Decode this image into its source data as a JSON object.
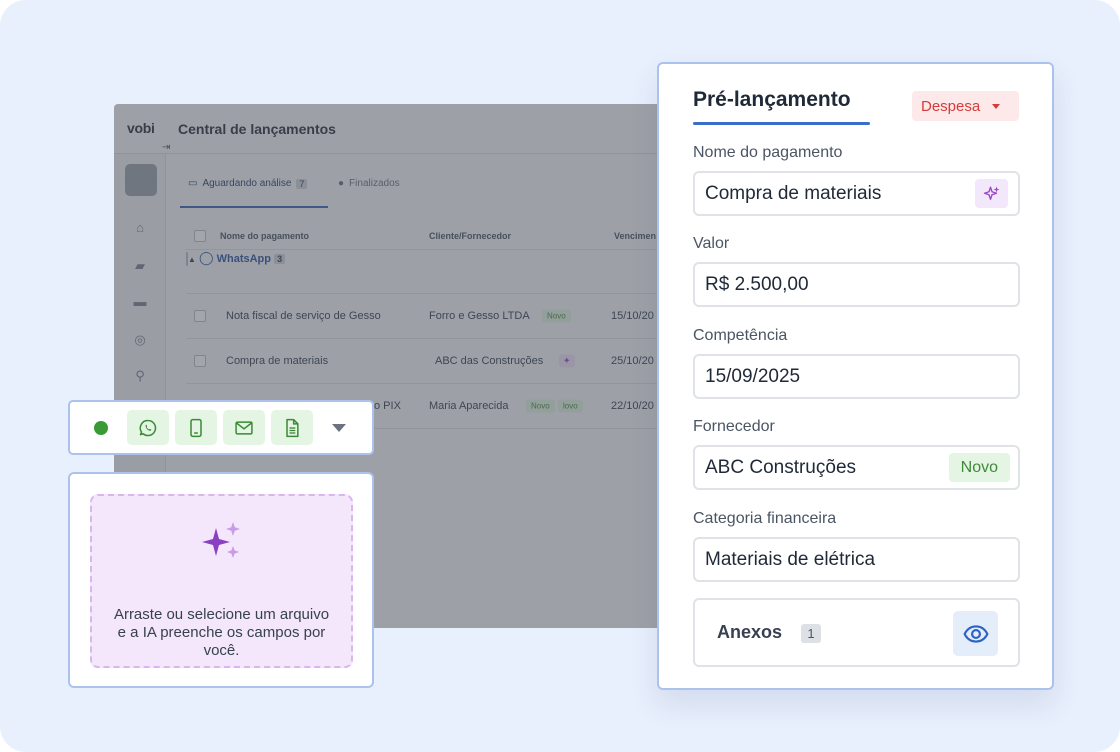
{
  "app": {
    "logo": "vobi",
    "title": "Central de lançamentos",
    "tabs": [
      {
        "label": "Aguardando análise",
        "count": "7"
      },
      {
        "label": "Finalizados"
      }
    ],
    "table": {
      "headers": [
        "Nome do pagamento",
        "Cliente/Fornecedor",
        "Vencimen"
      ],
      "group": {
        "label": "WhatsApp",
        "count": "3"
      },
      "rows": [
        {
          "name": "Nota fiscal de serviço de Gesso",
          "supplier": "Forro e Gesso LTDA",
          "badge": "Novo",
          "date": "15/10/20"
        },
        {
          "name": "Compra de materiais",
          "supplier": "ABC das Construções",
          "badge": "",
          "date": "25/10/20"
        },
        {
          "name": "o PIX",
          "supplier": "Maria Aparecida",
          "badge": "Novo",
          "badge2": "lovo",
          "date": "22/10/20"
        }
      ]
    }
  },
  "form": {
    "title": "Pré-lançamento",
    "type": "Despesa",
    "fields": [
      {
        "label": "Nome do pagamento",
        "value": "Compra de materiais"
      },
      {
        "label": "Valor",
        "value": "R$ 2.500,00"
      },
      {
        "label": "Competência",
        "value": "15/09/2025"
      },
      {
        "label": "Fornecedor",
        "value": "ABC Construções",
        "badge": "Novo"
      },
      {
        "label": "Categoria financeira",
        "value": "Materiais de elétrica"
      }
    ],
    "attachments": {
      "label": "Anexos",
      "count": "1"
    }
  },
  "toolbar": {
    "icons": [
      "status-dot",
      "whatsapp-icon",
      "phone-icon",
      "mail-icon",
      "document-icon",
      "chevron-down-icon"
    ]
  },
  "dropzone": {
    "text": "Arraste ou selecione um arquivo e a IA preenche os campos por você."
  },
  "colors": {
    "background": "#e8effd",
    "card_border": "#abc3ec",
    "accent_blue": "#3a6fc9",
    "expense_red": "#d63b3b",
    "new_green": "#3f8a3a",
    "ai_purple": "#9b47c6"
  }
}
